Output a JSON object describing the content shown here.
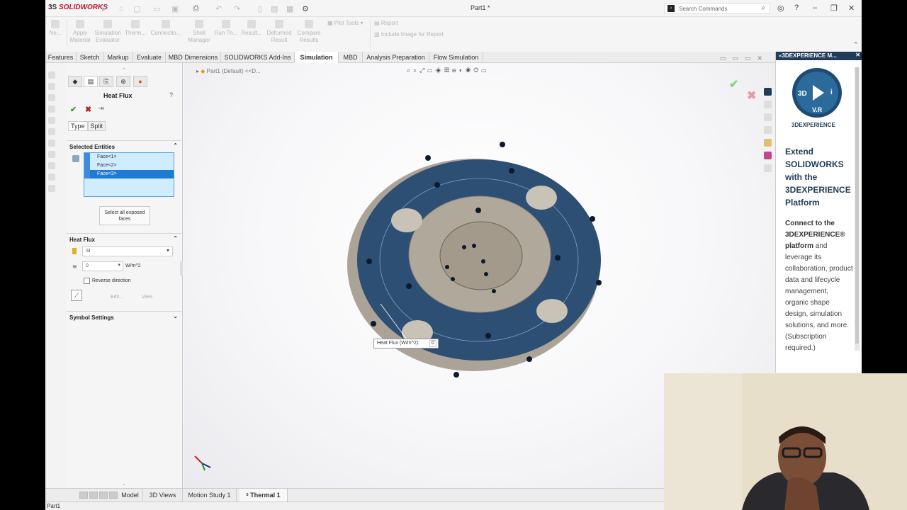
{
  "app": {
    "logo_prefix": "3S",
    "logo_name": "SOLIDWORKS",
    "document_title": "Part1 *",
    "search_placeholder": "Search Commands"
  },
  "command_manager": {
    "buttons": [
      "Ne...",
      "Apply Material",
      "Simulation Evaluator",
      "Therm...",
      "Connectio...",
      "Shell Manager",
      "Run Th...",
      "Result...",
      "Deformed Result",
      "Compare Results"
    ],
    "plot_tools": "Plot Tools",
    "report": "Report",
    "include_image": "Include Image for Report"
  },
  "tabs": [
    "Features",
    "Sketch",
    "Markup",
    "Evaluate",
    "MBD Dimensions",
    "SOLIDWORKS Add-Ins",
    "Simulation",
    "MBD",
    "Analysis Preparation",
    "Flow Simulation"
  ],
  "active_tab": "Simulation",
  "property_manager": {
    "title": "Heat Flux",
    "help": "?",
    "type_tabs": [
      "Type",
      "Split"
    ],
    "selected_entities_header": "Selected Entities",
    "faces": [
      "Face<1>",
      "Face<2>",
      "Face<3>"
    ],
    "select_all_button": "Select all exposed faces",
    "heat_flux_header": "Heat Flux",
    "unit_system": "SI",
    "flux_value": "0",
    "flux_unit": "W/m^2",
    "reverse_direction": "Reverse direction",
    "edit_label": "Edit...",
    "view_label": "View",
    "symbol_settings_header": "Symbol Settings"
  },
  "graphics": {
    "feature_tree_root": "Part1 (Default) <<D...",
    "callout_label": "Heat Flux (W/m^2):",
    "callout_value": "0"
  },
  "bottom_tabs": [
    "Model",
    "3D Views",
    "Motion Study 1",
    "Thermal 1"
  ],
  "active_bottom_tab": "Thermal 1",
  "status_bar": "Part1",
  "task_pane": {
    "header": "3DEXPERIENCE M...",
    "compass_3d": "3D",
    "compass_vr": "V.R",
    "compass_i": "i",
    "brand": "3DEXPERIENCE",
    "headline": [
      "Extend",
      "SOLIDWORKS",
      "with the",
      "3DEXPERIENCE",
      "Platform"
    ],
    "body_intro": "Connect to the",
    "body_brand": "3DEXPERIENCE® platform",
    "body_text": "and leverage its collaboration, product data and lifecycle management, organic shape design, simulation solutions, and more. (Subscription required.)"
  },
  "colors": {
    "part_blue": "#2e4f74",
    "part_tan": "#b0a89a",
    "selection_blue": "#1e7ad2",
    "brand_navy": "#1f3b57",
    "ok_green": "#3a9b2c",
    "cancel_red": "#c0202a"
  }
}
